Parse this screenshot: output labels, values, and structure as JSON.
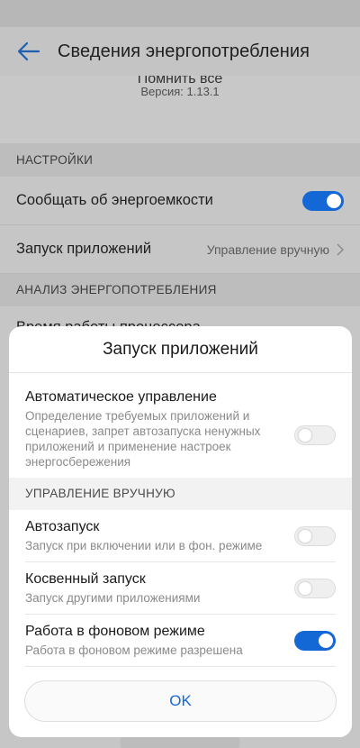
{
  "app_bar": {
    "title": "Сведения энергопотребления",
    "back_icon": "arrow-left-icon",
    "accent": "#1468d6"
  },
  "about": {
    "clipped_text": "Помнить все",
    "version": "Версия: 1.13.1"
  },
  "settings": {
    "header": "НАСТРОЙКИ",
    "notify_label": "Сообщать об энергоемкости",
    "notify_on": true,
    "launch_label": "Запуск приложений",
    "launch_value": "Управление вручную",
    "chevron_icon": "chevron-right-icon"
  },
  "analysis": {
    "header": "АНАЛИЗ ЭНЕРГОПОТРЕБЛЕНИЯ",
    "cut_row": "Время работы процессора"
  },
  "dialog": {
    "title": "Запуск приложений",
    "auto": {
      "label": "Автоматическое управление",
      "description": "Определение требуемых приложений и сценариев, запрет автозапуска ненужных приложений и применение настроек энергосбережения",
      "on": false
    },
    "manual_header": "УПРАВЛЕНИЕ ВРУЧНУЮ",
    "items": [
      {
        "label": "Автозапуск",
        "description": "Запуск при включении или в фон. режиме",
        "on": false
      },
      {
        "label": "Косвенный запуск",
        "description": "Запуск другими приложениями",
        "on": false
      },
      {
        "label": "Работа в фоновом режиме",
        "description": "Работа в фоновом режиме разрешена",
        "on": true
      }
    ],
    "ok_label": "OK"
  }
}
